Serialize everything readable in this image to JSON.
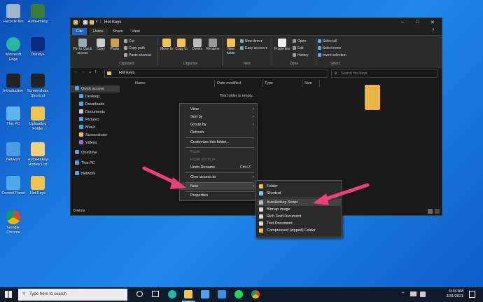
{
  "desktop": {
    "icons_left": [
      "Recycle Bin",
      "Microsoft Edge",
      "Introduction",
      "This PC",
      "Network",
      "Control Panel",
      "Google Chrome"
    ],
    "icons_right": [
      "AutoHotkey",
      "Disney+",
      "Screenshots Shortcut",
      "Uploading Folder",
      "AutoHotkey Hotkey List",
      "Hot Keys"
    ]
  },
  "window": {
    "title": "Hot Keys",
    "quick_toolbar_sep": "|",
    "dropdown": "▾",
    "tabs": [
      "File",
      "Home",
      "Share",
      "View"
    ],
    "ribbon": {
      "pin": "Pin to Quick access",
      "copy": "Copy",
      "paste": "Paste",
      "cut": "Cut",
      "copy_path": "Copy path",
      "paste_shortcut": "Paste shortcut",
      "move_to": "Move to",
      "copy_to": "Copy to",
      "delete": "Delete",
      "rename": "Rename",
      "new_folder": "New folder",
      "new_item": "New item ▾",
      "easy_access": "Easy access ▾",
      "properties": "Properties",
      "open": "Open",
      "edit": "Edit",
      "history": "History",
      "select_all": "Select all",
      "select_none": "Select none",
      "invert_selection": "Invert selection",
      "groups": [
        "Clipboard",
        "Organize",
        "New",
        "Open",
        "Select"
      ]
    },
    "address": "Hot Keys",
    "search_placeholder": "Search Hot Keys",
    "nav_arrows": [
      "←",
      "→",
      "⌄",
      "↑"
    ],
    "nav": [
      "Quick access",
      "Desktop",
      "Downloads",
      "Documents",
      "Pictures",
      "Music",
      "Screenshots",
      "Videos",
      "OneDrive",
      "This PC",
      "Network"
    ],
    "columns": [
      "Name",
      "Date modified",
      "Type",
      "Size"
    ],
    "empty_text": "This folder is empty.",
    "status": "0 items",
    "controls": [
      "–",
      "□",
      "✕"
    ]
  },
  "context_menu": {
    "items": [
      "View",
      "Sort by",
      "Group by",
      "Refresh",
      "Customize this folder...",
      "Paste",
      "Paste shortcut",
      "Undo Rename",
      "Give access to",
      "New",
      "Properties"
    ],
    "undo_shortcut": "Ctrl+Z",
    "arrow": "›"
  },
  "submenu": {
    "items": [
      "Folder",
      "Shortcut",
      "AutoHotkey Script",
      "Bitmap image",
      "Rich Text Document",
      "Text Document",
      "Compressed (zipped) Folder"
    ]
  },
  "taskbar": {
    "search": "Type here to search",
    "time": "9:34 AM",
    "date": "3/31/2021"
  },
  "colors": {
    "accent": "#1966c8",
    "arrow": "#f0407a"
  }
}
